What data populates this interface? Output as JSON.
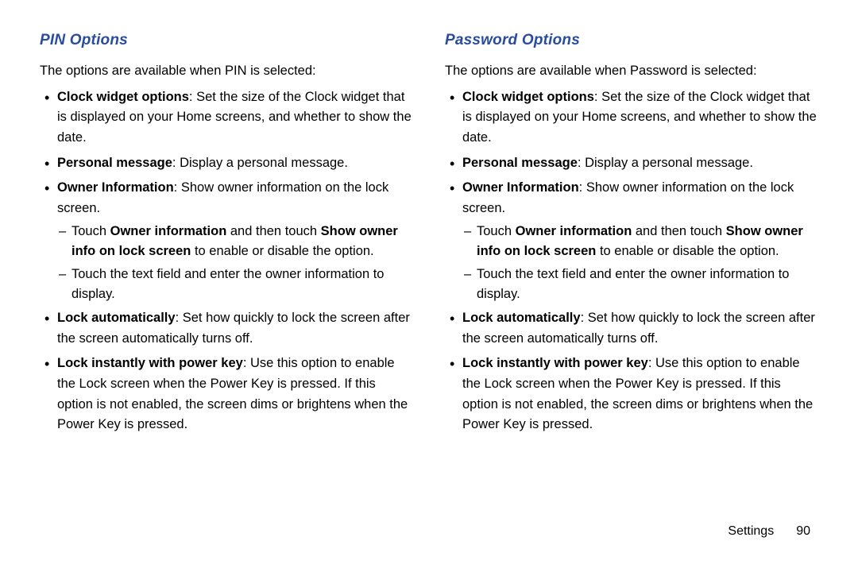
{
  "left": {
    "heading": "PIN Options",
    "intro": "The options are available when PIN is selected:",
    "items": [
      {
        "lead": "Clock widget options",
        "rest": ": Set the size of the Clock widget that is displayed on your Home screens, and whether to show the date."
      },
      {
        "lead": "Personal message",
        "rest": ": Display a personal message."
      },
      {
        "lead": "Owner Information",
        "rest": ": Show owner information on the lock screen.",
        "sub": [
          {
            "pre": "Touch ",
            "b1": "Owner information",
            "mid": " and then touch ",
            "b2": "Show owner info on lock screen",
            "post": " to enable or disable the option."
          },
          {
            "plain": "Touch the text field and enter the owner information to display."
          }
        ]
      },
      {
        "lead": "Lock automatically",
        "rest": ": Set how quickly to lock the screen after the screen automatically turns off."
      },
      {
        "lead": "Lock instantly with power key",
        "rest": ": Use this option to enable the Lock screen when the Power Key is pressed. If this option is not enabled, the screen dims or brightens when the Power Key is pressed."
      }
    ]
  },
  "right": {
    "heading": "Password Options",
    "intro": "The options are available when Password is selected:",
    "items": [
      {
        "lead": "Clock widget options",
        "rest": ": Set the size of the Clock widget that is displayed on your Home screens, and whether to show the date."
      },
      {
        "lead": "Personal message",
        "rest": ": Display a personal message."
      },
      {
        "lead": "Owner Information",
        "rest": ": Show owner information on the lock screen.",
        "sub": [
          {
            "pre": "Touch ",
            "b1": "Owner information",
            "mid": " and then touch ",
            "b2": "Show owner info on lock screen",
            "post": " to enable or disable the option."
          },
          {
            "plain": "Touch the text field and enter the owner information to display."
          }
        ]
      },
      {
        "lead": "Lock automatically",
        "rest": ": Set how quickly to lock the screen after the screen automatically turns off."
      },
      {
        "lead": "Lock instantly with power key",
        "rest": ": Use this option to enable the Lock screen when the Power Key is pressed. If this option is not enabled, the screen dims or brightens when the Power Key is pressed."
      }
    ]
  },
  "footer": {
    "section": "Settings",
    "page": "90"
  }
}
